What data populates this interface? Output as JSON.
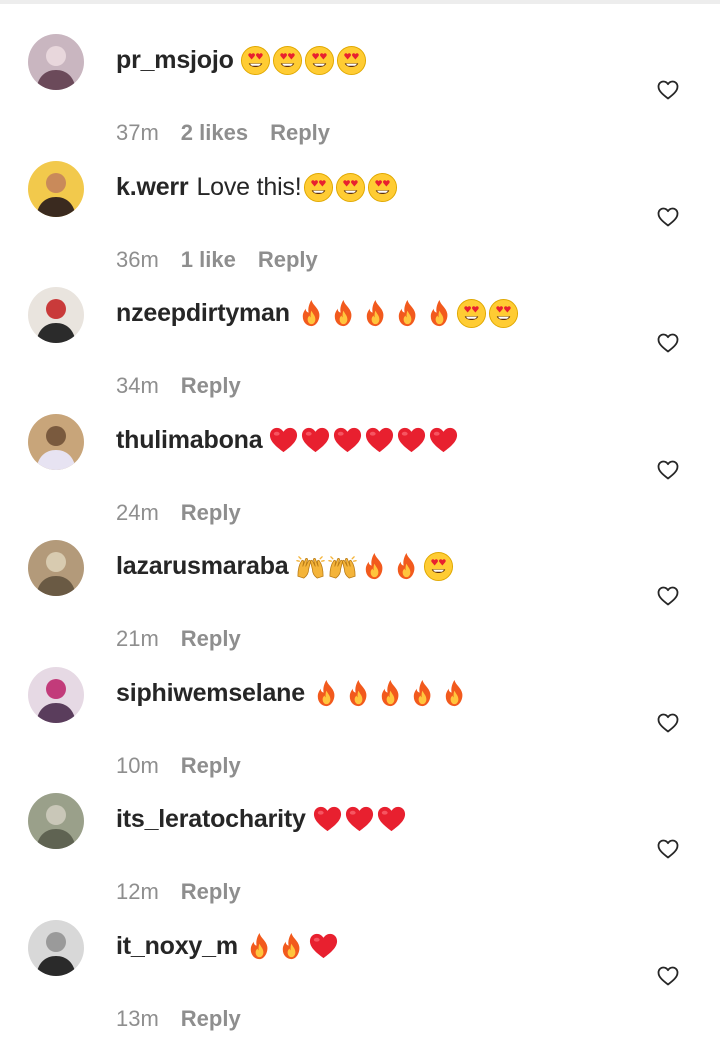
{
  "comments": [
    {
      "username": "pr_msjojo",
      "text": "",
      "emojis": [
        "heart-eyes-face",
        "heart-eyes-face",
        "heart-eyes-face",
        "heart-eyes-face"
      ],
      "time": "37m",
      "likes": "2 likes",
      "reply": "Reply",
      "avatar_colors": [
        "#c9b6c0",
        "#6b4a5a",
        "#e8d7dc"
      ]
    },
    {
      "username": "k.werr",
      "text": "Love this!",
      "emojis": [
        "heart-eyes-face",
        "heart-eyes-face",
        "heart-eyes-face"
      ],
      "time": "36m",
      "likes": "1 like",
      "reply": "Reply",
      "avatar_colors": [
        "#f2c94c",
        "#3a2a1f",
        "#c98a5a"
      ]
    },
    {
      "username": "nzeepdirtyman",
      "text": "",
      "emojis": [
        "fire",
        "fire",
        "fire",
        "fire",
        "fire",
        "heart-eyes-face",
        "heart-eyes-face"
      ],
      "time": "34m",
      "likes": "",
      "reply": "Reply",
      "avatar_colors": [
        "#e9e4de",
        "#2b2b2b",
        "#c93a3a"
      ]
    },
    {
      "username": "thulimabona",
      "text": "",
      "emojis": [
        "red-heart",
        "red-heart",
        "red-heart",
        "red-heart",
        "red-heart",
        "red-heart"
      ],
      "time": "24m",
      "likes": "",
      "reply": "Reply",
      "avatar_colors": [
        "#c8a57a",
        "#e7e3f2",
        "#7a5a3e"
      ]
    },
    {
      "username": "lazarusmaraba",
      "text": "",
      "emojis": [
        "raising-hands",
        "raising-hands",
        "fire",
        "fire",
        "heart-eyes-face"
      ],
      "time": "21m",
      "likes": "",
      "reply": "Reply",
      "avatar_colors": [
        "#b39a7a",
        "#6a5a44",
        "#d8cbb0"
      ]
    },
    {
      "username": "siphiwemselane",
      "text": "",
      "emojis": [
        "fire",
        "fire",
        "fire",
        "fire",
        "fire"
      ],
      "time": "10m",
      "likes": "",
      "reply": "Reply",
      "avatar_colors": [
        "#e6d9e4",
        "#5a3d5c",
        "#c23b7a"
      ]
    },
    {
      "username": "its_leratocharity",
      "text": "",
      "emojis": [
        "red-heart",
        "red-heart",
        "red-heart"
      ],
      "time": "12m",
      "likes": "",
      "reply": "Reply",
      "avatar_colors": [
        "#9aa08a",
        "#5f6352",
        "#c9c7b8"
      ]
    },
    {
      "username": "it_noxy_m",
      "text": "",
      "emojis": [
        "fire",
        "fire",
        "red-heart"
      ],
      "time": "13m",
      "likes": "",
      "reply": "Reply",
      "avatar_colors": [
        "#d8d8d8",
        "#2a2a2a",
        "#9a9a9a"
      ]
    }
  ],
  "like_icon": "heart-outline-icon",
  "colors": {
    "text": "#262626",
    "meta": "#8e8e8e",
    "icon": "#262626",
    "red_heart": "#e8202f",
    "fire_outer": "#f25a1d",
    "fire_inner": "#ffc53d",
    "face": "#ffcc33",
    "face_heart": "#e8202f"
  }
}
